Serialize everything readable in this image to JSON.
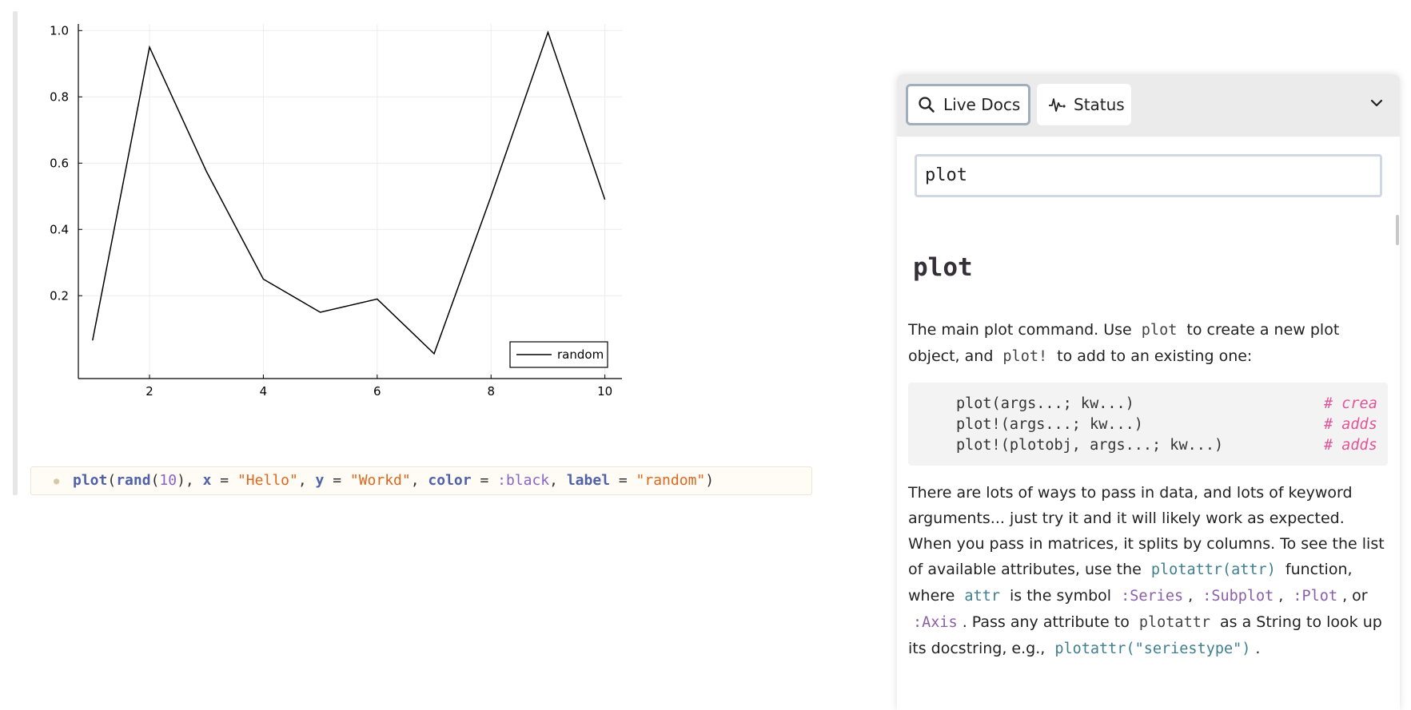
{
  "chart_data": {
    "type": "line",
    "x": [
      1,
      2,
      3,
      4,
      5,
      6,
      7,
      8,
      9,
      10
    ],
    "series": [
      {
        "name": "random",
        "values": [
          0.065,
          0.95,
          0.575,
          0.25,
          0.15,
          0.19,
          0.025,
          0.5,
          0.995,
          0.49
        ],
        "color": "#000000"
      }
    ],
    "xticks": [
      "2",
      "4",
      "6",
      "8",
      "10"
    ],
    "yticks": [
      "0.2",
      "0.4",
      "0.6",
      "0.8",
      "1.0"
    ],
    "xlim": [
      0.75,
      10.3
    ],
    "ylim": [
      -0.05,
      1.02
    ],
    "grid": true,
    "legend_position": "bottom-right"
  },
  "code": {
    "fn": "plot",
    "p1": "(",
    "rand": "rand",
    "p2": "(",
    "num": "10",
    "p3": "), ",
    "kx": "x",
    "eq1": " = ",
    "sx": "\"Hello\"",
    "c1": ", ",
    "ky": "y",
    "eq2": " = ",
    "sy": "\"Workd\"",
    "c2": ", ",
    "kc": "color",
    "eq3": " = ",
    "sc": ":black",
    "c3": ", ",
    "kl": "label",
    "eq4": " = ",
    "sl": "\"random\"",
    "p4": ")"
  },
  "panel": {
    "tabs": {
      "live_docs": "Live Docs",
      "status": "Status"
    },
    "search_value": "plot",
    "doc": {
      "title": "plot",
      "p1": {
        "t1": "The main plot command. Use",
        "c1": "plot",
        "t2": "to create a new plot object, and",
        "c2": "plot!",
        "t3": "to add to an existing one:"
      },
      "code_lines": [
        "plot(args...; kw...)",
        "plot!(args...; kw...)",
        "plot!(plotobj, args...; kw...)"
      ],
      "code_comments": [
        "# crea",
        "# adds",
        "# adds"
      ],
      "p2": {
        "t1": "There are lots of ways to pass in data, and lots of keyword arguments... just try it and it will likely work as expected. When you pass in matrices, it splits by columns. To see the list of available attributes, use the",
        "c1": "plotattr(attr)",
        "t2": "function, where",
        "c2": "attr",
        "t3": "is the symbol",
        "c3": ":Series",
        "t4": ",",
        "c4": ":Subplot",
        "t5": ",",
        "c5": ":Plot",
        "t6": ", or",
        "c6": ":Axis",
        "t7": ". Pass any attribute to",
        "c7": "plotattr",
        "t8": "as a String to look up its docstring, e.g.,",
        "c8": "plotattr(\"seriestype\")",
        "t9": "."
      }
    }
  }
}
